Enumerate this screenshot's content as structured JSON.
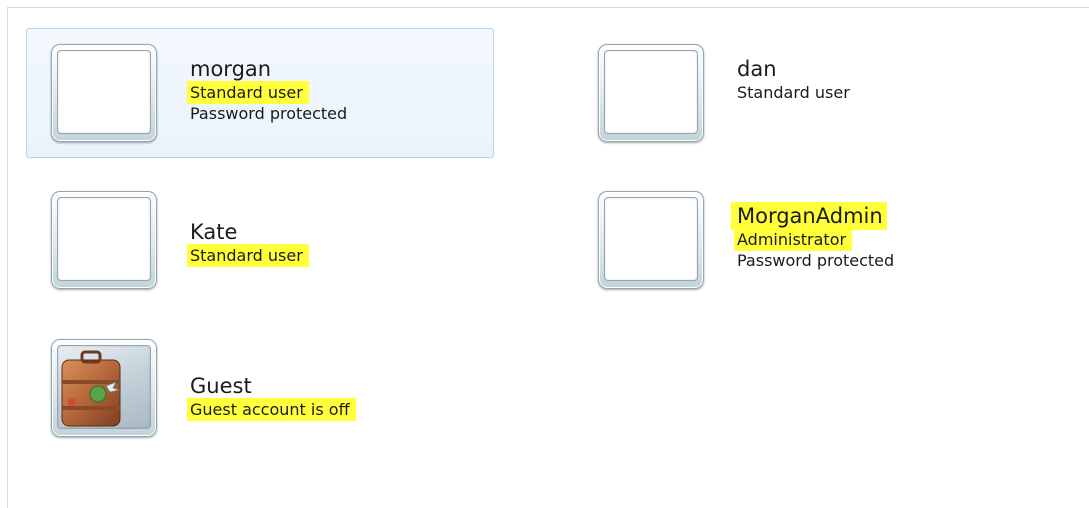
{
  "accounts": [
    {
      "name": "morgan",
      "type": "Standard user",
      "status": "Password protected"
    },
    {
      "name": "dan",
      "type": "Standard user",
      "status": ""
    },
    {
      "name": "Kate",
      "type": "Standard user",
      "status": ""
    },
    {
      "name": "MorganAdmin",
      "type": "Administrator",
      "status": "Password protected"
    },
    {
      "name": "Guest",
      "type": "Guest account is off",
      "status": ""
    }
  ],
  "highlight_color": "#ffff3a",
  "selection_border_color": "#b9d3ec",
  "icons": {
    "default_avatar": "blank-avatar-icon",
    "guest_avatar": "suitcase-icon"
  }
}
